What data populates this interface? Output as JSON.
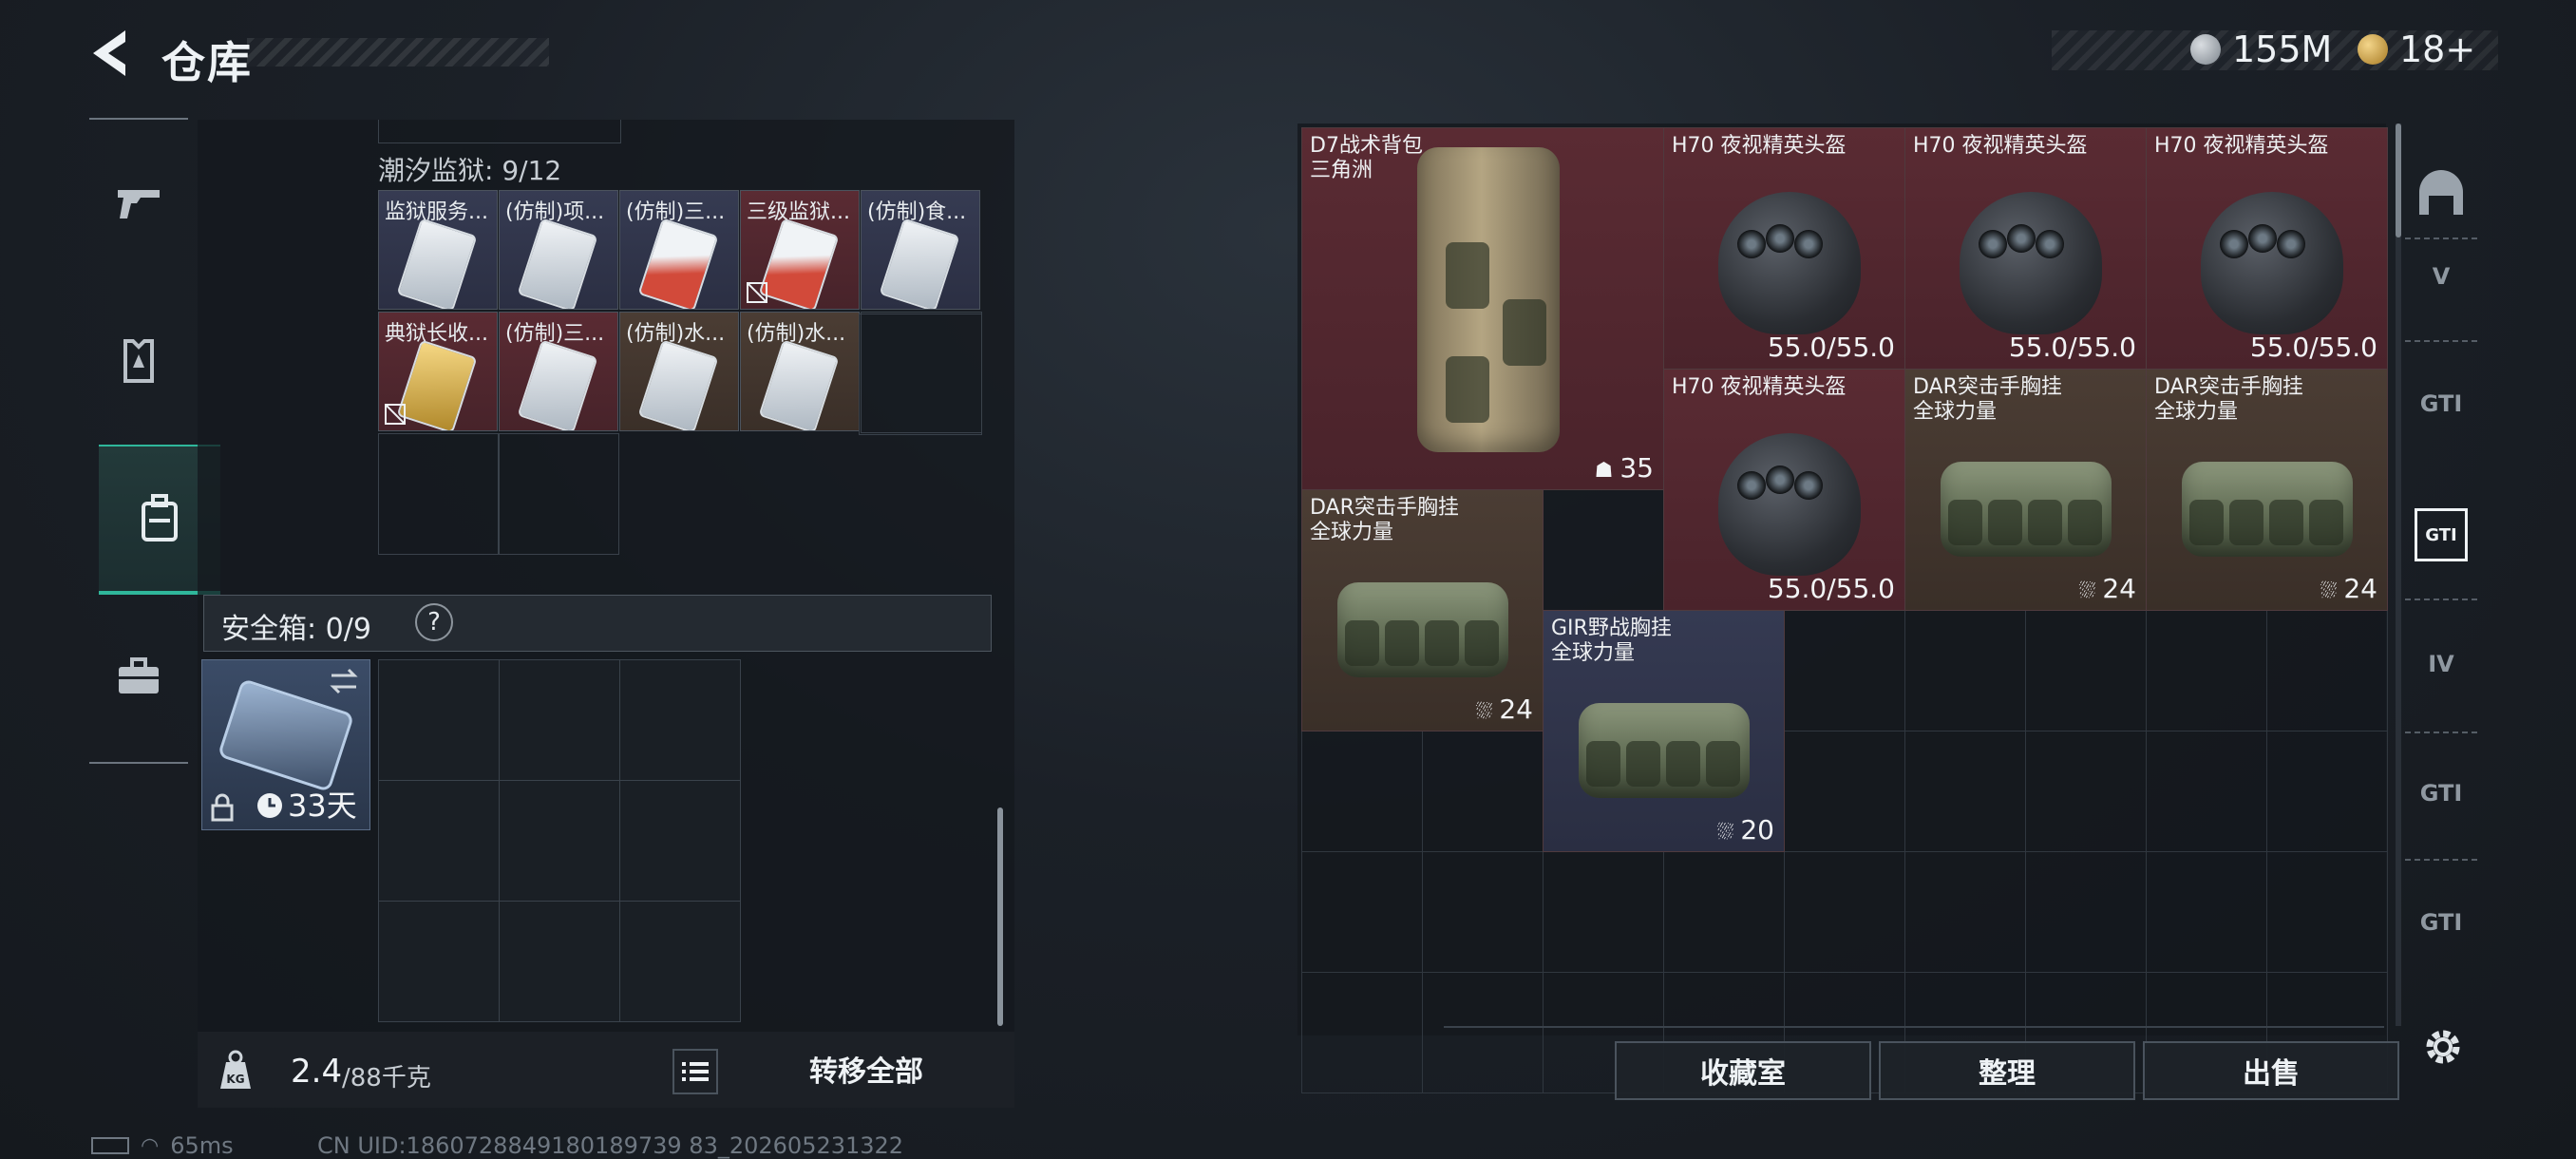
{
  "header": {
    "title": "仓库",
    "currencies": [
      {
        "icon": "credit-coin-icon",
        "value": "155M"
      },
      {
        "icon": "gold-coin-icon",
        "value": "18+"
      }
    ]
  },
  "left_nav": [
    {
      "icon": "pistol-icon"
    },
    {
      "icon": "armor-icon"
    },
    {
      "icon": "backpack-icon",
      "active": true
    },
    {
      "icon": "briefcase-icon"
    }
  ],
  "container": {
    "title": "潮汐监狱: 9/12",
    "items": [
      {
        "name": "监狱服务...",
        "bg": "blue",
        "card": "silver"
      },
      {
        "name": "(仿制)项...",
        "bg": "blue",
        "card": "silver"
      },
      {
        "name": "(仿制)三...",
        "bg": "blue",
        "card": "red"
      },
      {
        "name": "三级监狱...",
        "bg": "red",
        "card": "red",
        "unbound": true
      },
      {
        "name": "(仿制)食...",
        "bg": "blue",
        "card": "silver"
      },
      {
        "name": "典狱长收...",
        "bg": "red",
        "card": "gold",
        "unbound": true
      },
      {
        "name": "(仿制)三...",
        "bg": "red",
        "card": "silver"
      },
      {
        "name": "(仿制)水...",
        "bg": "brown",
        "card": "silver"
      },
      {
        "name": "(仿制)水...",
        "bg": "brown",
        "card": "silver"
      }
    ]
  },
  "safe_box": {
    "label": "安全箱: 0/9",
    "help": "?",
    "duration": "33天"
  },
  "weight": {
    "current": "2.4",
    "max": "/88千克"
  },
  "buttons": {
    "transfer_all": "转移全部",
    "collection": "收藏室",
    "sort": "整理",
    "sell": "出售"
  },
  "stash_items": [
    {
      "name": "D7战术背包",
      "sub": "三角洲",
      "value": "35",
      "value_icon": "capacity-icon",
      "bg": "red"
    },
    {
      "name": "H70 夜视精英头盔",
      "value": "55.0/55.0",
      "bg": "red"
    },
    {
      "name": "H70 夜视精英头盔",
      "value": "55.0/55.0",
      "bg": "red"
    },
    {
      "name": "H70 夜视精英头盔",
      "value": "55.0/55.0",
      "bg": "red"
    },
    {
      "name": "H70 夜视精英头盔",
      "value": "55.0/55.0",
      "bg": "red"
    },
    {
      "name": "DAR突击手胸挂",
      "sub": "全球力量",
      "value": "24",
      "value_icon": "vest-capacity-icon",
      "bg": "brown"
    },
    {
      "name": "DAR突击手胸挂",
      "sub": "全球力量",
      "value": "24",
      "value_icon": "vest-capacity-icon",
      "bg": "brown"
    },
    {
      "name": "DAR突击手胸挂",
      "sub": "全球力量",
      "value": "24",
      "value_icon": "vest-capacity-icon",
      "bg": "brown"
    },
    {
      "name": "GIR野战胸挂",
      "sub": "全球力量",
      "value": "20",
      "value_icon": "vest-capacity-icon",
      "bg": "blue"
    }
  ],
  "right_nav": [
    {
      "icon": "helmet-slot-icon",
      "label": ""
    },
    {
      "icon": "stash-v-icon",
      "label": "V"
    },
    {
      "icon": "stash-gti-icon",
      "label": "GTI"
    },
    {
      "icon": "stash-gti-active-icon",
      "label": "GTI"
    },
    {
      "icon": "stash-iv-icon",
      "label": "IV"
    },
    {
      "icon": "stash-gti-2-icon",
      "label": "GTI"
    },
    {
      "icon": "stash-gti-3-icon",
      "label": "GTI"
    }
  ],
  "status": {
    "ping": "65ms",
    "uid": "CN UID:1860728849180189739 83_202605231322"
  },
  "colors": {
    "accent": "#2fb79b",
    "red_rarity": "#5a2b33",
    "brown_rarity": "#4b3d34",
    "blue_rarity": "#353a52"
  }
}
